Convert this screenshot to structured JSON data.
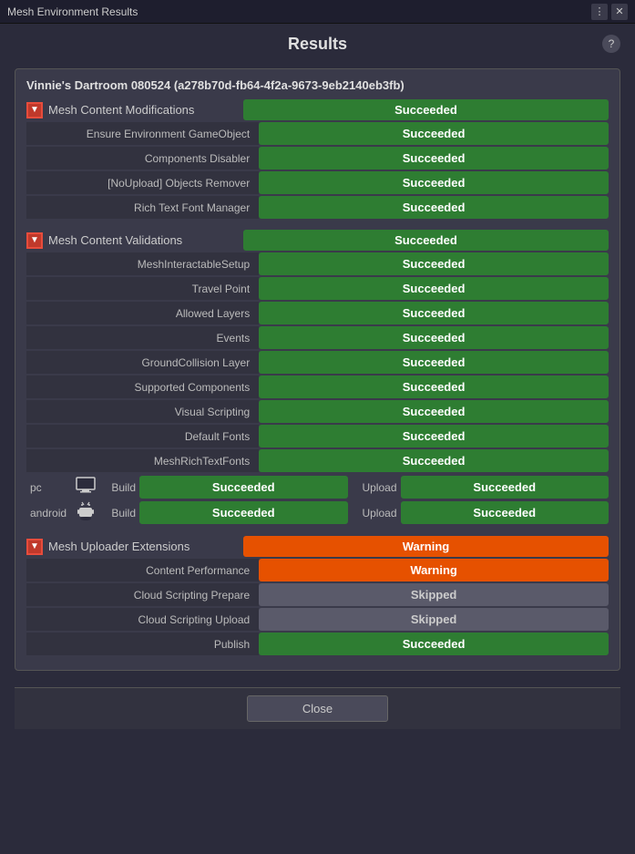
{
  "titleBar": {
    "title": "Mesh Environment Results",
    "moreBtn": "⋮",
    "closeBtn": "✕"
  },
  "header": {
    "resultsLabel": "Results",
    "helpIcon": "?",
    "envTitle": "Vinnie's Dartroom 080524 (a278b70d-fb64-4f2a-9673-9eb2140eb3fb)"
  },
  "sections": [
    {
      "id": "mesh-content-modifications",
      "toggle": "▼",
      "label": "Mesh Content Modifications",
      "status": "Succeeded",
      "statusClass": "status-succeeded",
      "rows": [
        {
          "label": "Ensure Environment GameObject",
          "status": "Succeeded",
          "statusClass": "status-succeeded"
        },
        {
          "label": "Components Disabler",
          "status": "Succeeded",
          "statusClass": "status-succeeded"
        },
        {
          "label": "[NoUpload] Objects Remover",
          "status": "Succeeded",
          "statusClass": "status-succeeded"
        },
        {
          "label": "Rich Text Font Manager",
          "status": "Succeeded",
          "statusClass": "status-succeeded"
        }
      ]
    },
    {
      "id": "mesh-content-validations",
      "toggle": "▼",
      "label": "Mesh Content Validations",
      "status": "Succeeded",
      "statusClass": "status-succeeded",
      "rows": [
        {
          "label": "MeshInteractableSetup",
          "status": "Succeeded",
          "statusClass": "status-succeeded"
        },
        {
          "label": "Travel Point",
          "status": "Succeeded",
          "statusClass": "status-succeeded"
        },
        {
          "label": "Allowed Layers",
          "status": "Succeeded",
          "statusClass": "status-succeeded"
        },
        {
          "label": "Events",
          "status": "Succeeded",
          "statusClass": "status-succeeded"
        },
        {
          "label": "GroundCollision Layer",
          "status": "Succeeded",
          "statusClass": "status-succeeded"
        },
        {
          "label": "Supported Components",
          "status": "Succeeded",
          "statusClass": "status-succeeded"
        },
        {
          "label": "Visual Scripting",
          "status": "Succeeded",
          "statusClass": "status-succeeded"
        },
        {
          "label": "Default Fonts",
          "status": "Succeeded",
          "statusClass": "status-succeeded"
        },
        {
          "label": "MeshRichTextFonts",
          "status": "Succeeded",
          "statusClass": "status-succeeded"
        }
      ]
    }
  ],
  "platforms": [
    {
      "id": "pc",
      "label": "pc",
      "icon": "🖥",
      "buildLabel": "Build",
      "buildStatus": "Succeeded",
      "buildStatusClass": "status-succeeded",
      "uploadLabel": "Upload",
      "uploadStatus": "Succeeded",
      "uploadStatusClass": "status-succeeded"
    },
    {
      "id": "android",
      "label": "android",
      "icon": "📱",
      "buildLabel": "Build",
      "buildStatus": "Succeeded",
      "buildStatusClass": "status-succeeded",
      "uploadLabel": "Upload",
      "uploadStatus": "Succeeded",
      "uploadStatusClass": "status-succeeded"
    }
  ],
  "extensions": {
    "id": "mesh-uploader-extensions",
    "toggle": "▼",
    "label": "Mesh Uploader Extensions",
    "status": "Warning",
    "statusClass": "status-warning",
    "rows": [
      {
        "label": "Content Performance",
        "status": "Warning",
        "statusClass": "status-warning"
      },
      {
        "label": "Cloud Scripting Prepare",
        "status": "Skipped",
        "statusClass": "status-skipped"
      },
      {
        "label": "Cloud Scripting Upload",
        "status": "Skipped",
        "statusClass": "status-skipped"
      },
      {
        "label": "Publish",
        "status": "Succeeded",
        "statusClass": "status-succeeded"
      }
    ]
  },
  "closeButton": "Close"
}
